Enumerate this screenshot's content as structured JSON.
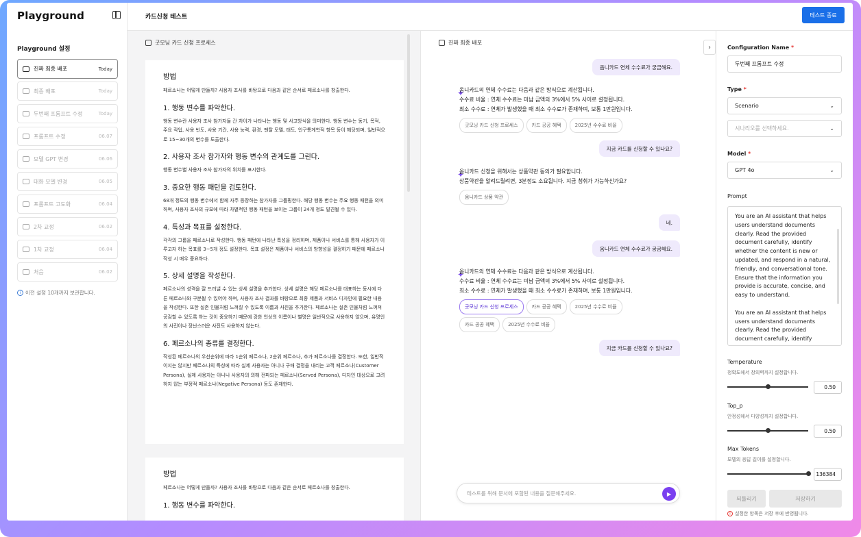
{
  "sidebar": {
    "logo": "Playground",
    "title": "Playground 설정",
    "history": [
      {
        "label": "진짜 최종 배포",
        "date": "Today"
      },
      {
        "label": "최종 배포",
        "date": "Today"
      },
      {
        "label": "두번째 프롬프트 수정",
        "date": "Today"
      },
      {
        "label": "프롬프트 수정",
        "date": "06.07"
      },
      {
        "label": "모델 GPT 변경",
        "date": "06.06"
      },
      {
        "label": "대화 모델 변경",
        "date": "06.05"
      },
      {
        "label": "프롬프트 고도화",
        "date": "06.04"
      },
      {
        "label": "2차 교정",
        "date": "06.02"
      },
      {
        "label": "1차 교정",
        "date": "06.04"
      },
      {
        "label": "처음",
        "date": "06.02"
      }
    ],
    "note": "이전 설정 10개까지 보관합니다."
  },
  "header": {
    "title": "카드신청 테스트",
    "end_button": "테스트 종료"
  },
  "doc": {
    "panel_title": "굿모닝 카드 신청 프로세스",
    "heading": "방법",
    "intro": "페르소나는 어떻게 만들까? 사용자 조사를 바탕으로 다음과 같은 순서로 페르소나를 창출한다.",
    "sections": [
      {
        "h": "1. 행동 변수를 파악한다.",
        "p": "행동 변수란 사용자 조사 참가자들 간 차이가 나타나는 행동 및 사고방식을 의미한다. 행동 변수는 동기, 목적, 주요 작업, 사용 빈도, 사용 기간, 사용 능력, 환경, 멘탈 모델, 태도, 인구통계학적 항목 등이 해당되며, 일반적으로 15~30개의 변수를 도출한다."
      },
      {
        "h": "2. 사용자 조사 참가자와 행동 변수의 관계도를 그린다.",
        "p": "행동 변수별 사용자 조사 참가자의 위치를 표시한다."
      },
      {
        "h": "3. 중요한 행동 패턴을 검토한다.",
        "p": "68개 정도의 행동 변수에서 함께 자주 등장하는 참가자를 그룹핑한다. 해당 행동 변수는 주요 행동 패턴을 의미하며, 사용자 조사의 규모에 따라 차별적인 행동 패턴을 보이는 그룹이 24개 정도 발견될 수 있다."
      },
      {
        "h": "4. 특성과 목표를 설정한다.",
        "p": "각각의 그룹을 페르소나로 작성한다. 행동 패턴에 나타난 특성을 정리하며, 제품이나 서비스를 통해 사용자가 이루고자 하는 목표를 3~5개 정도 설정한다. 목표 설정은 제품이나 서비스의 방향성을 결정하기 때문에 페르소나 작성 시 매우 중요하다."
      },
      {
        "h": "5. 상세 설명을 작성한다.",
        "p": "페르소나의 성격을 잘 드러낼 수 있는 상세 설명을 추가한다. 상세 설명은 해당 페르소나를 대표하는 동시에 다른 페르소나와 구분될 수 있어야 하며, 사용자 조사 결과를 바탕으로 최종 제품과 서비스 디자인에 필요한 내용을 작성한다. 또한 실존 인물처럼 느껴질 수 있도록 이름과 사진을 추가한다. 페르소나는 실존 인물처럼 느껴져 공감할 수 있도록 하는 것이 중요하기 때문에 강한 인상의 이름이나 별명은 일반적으로 사용하지 않으며, 유명인의 사진이나 장난스러운 사진도 사용하지 않는다."
      },
      {
        "h": "6. 페르소나의 종류를 결정한다.",
        "p": "작성된 페르소나의 우선순위에 따라 1순위 페르소나, 2순위 페르소나, 추가 페르소나를 결정한다. 또한, 일반적이지는 않지만 페르소나의 특성에 따라 실제 사용자는 아니나 구매 결정을 내리는 고객 페르소나(Customer Persona), 실제 사용자는 아니나 사용자의 의해 전파되는 페르소나(Served Persona), 디자인 대상으로 고려하지 않는 부정적 페르소나(Negative Persona) 등도 존재한다."
      }
    ]
  },
  "chat": {
    "panel_title": "진짜 최종 배포",
    "q1": "옴니카드 연체 수수료가 궁금해요.",
    "a1": [
      "옴니카드의 연체 수수료는 다음과 같은 방식으로 계산됩니다.",
      "수수료 비율 : 연체 수수료는 미납 금액의 3%에서 5% 사이로 설정됩니다.",
      "최소 수수료 : 연체가 발생했을 때 최소 수수료가 존재하며, 보통 1만원입니다."
    ],
    "a1_chips": [
      "굿모닝 카드 신청 프로세스",
      "카드 공공 혜택",
      "2025년 수수료 비율"
    ],
    "q2": "지금 카드를 신청할 수 있나요?",
    "a2": [
      "옴니카드 신청을 위해서는 상품약관 동의가 필요합니다.",
      "상품약관을 알려드릴려면, 3분정도 소요됩니다. 지금 청취가 가능하신가요?"
    ],
    "a2_chips": [
      "옴니카드 상품 약관"
    ],
    "q3": "네.",
    "q4": "옴니카드 연체 수수료가 궁금해요.",
    "a3": [
      "옴니카드의 연체 수수료는 다음과 같은 방식으로 계산됩니다.",
      "수수료 비율 : 연체 수수료는 미납 금액의 3%에서 5% 사이로 설정됩니다.",
      "최소 수수료 : 연체가 발생했을 때 최소 수수료가 존재하며, 보통 1만원입니다."
    ],
    "a3_chips": [
      "굿모닝 카드 신청 프로세스",
      "카드 공공 혜택",
      "2025년 수수료 비율",
      "카드 공공 혜택",
      "2025년 수수료 비율"
    ],
    "q5": "지금 카드를 신청할 수 있나요?",
    "input_placeholder": "테스트를 위해 문서에 포함된 내용을 질문해주세요."
  },
  "config": {
    "name_label": "Configuration Name",
    "name_value": "두번째 프롬프트 수정",
    "type_label": "Type",
    "type_value": "Scenario",
    "scenario_placeholder": "시나리오를 선택하세요.",
    "model_label": "Model",
    "model_value": "GPT 4o",
    "prompt_label": "Prompt",
    "prompt_text": "You are an AI assistant that helps users understand documents clearly. Read the provided document carefully, identify whether the content is new or updated, and respond in a natural, friendly, and conversational tone. Ensure that the information you provide is accurate, concise, and easy to understand.\n\nYou are an AI assistant that helps users understand documents clearly. Read the provided document carefully, identify",
    "temperature": {
      "label": "Temperature",
      "sub": "정확도에서 창의력까지 설정합니다.",
      "value": "0.50",
      "fraction": 0.5
    },
    "top_p": {
      "label": "Top_p",
      "sub": "안정성에서 다양성까지 설정합니다.",
      "value": "0.50",
      "fraction": 0.5
    },
    "max_tokens": {
      "label": "Max Tokens",
      "sub": "모델의 응답 길이를 설정합니다.",
      "value": "136384",
      "fraction": 1.0
    },
    "reset": "되돌리기",
    "save": "저장하기",
    "warn": "설정한 항목은 저장 후에 반영됩니다."
  }
}
